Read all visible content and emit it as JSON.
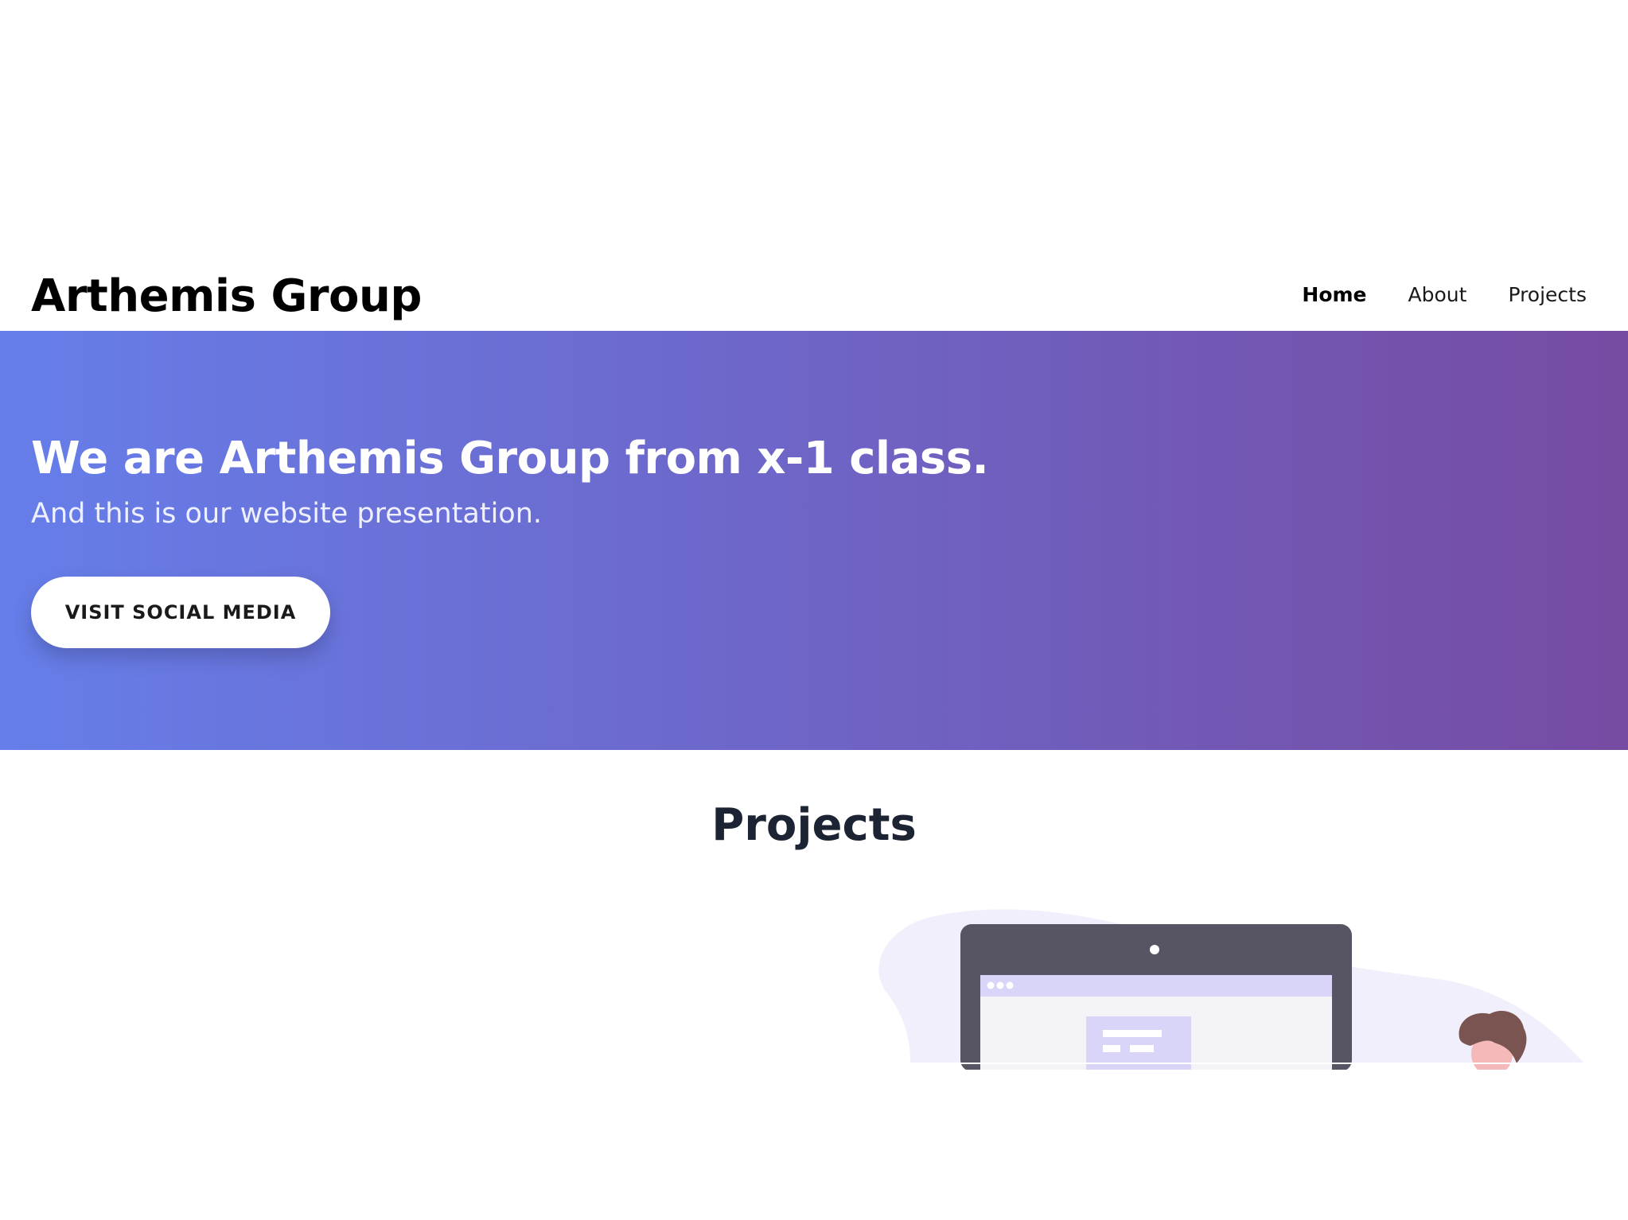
{
  "header": {
    "brand": "Arthemis Group",
    "nav": [
      {
        "label": "Home",
        "active": true
      },
      {
        "label": "About",
        "active": false
      },
      {
        "label": "Projects",
        "active": false
      }
    ]
  },
  "hero": {
    "title": "We are Arthemis Group from x-1 class.",
    "subtitle": "And this is our website presentation.",
    "button_label": "VISIT SOCIAL MEDIA",
    "gradient_start": "#667eea",
    "gradient_end": "#764ba2"
  },
  "projects": {
    "title": "Projects",
    "illustration_icon": "laptop-with-person-illustration"
  }
}
